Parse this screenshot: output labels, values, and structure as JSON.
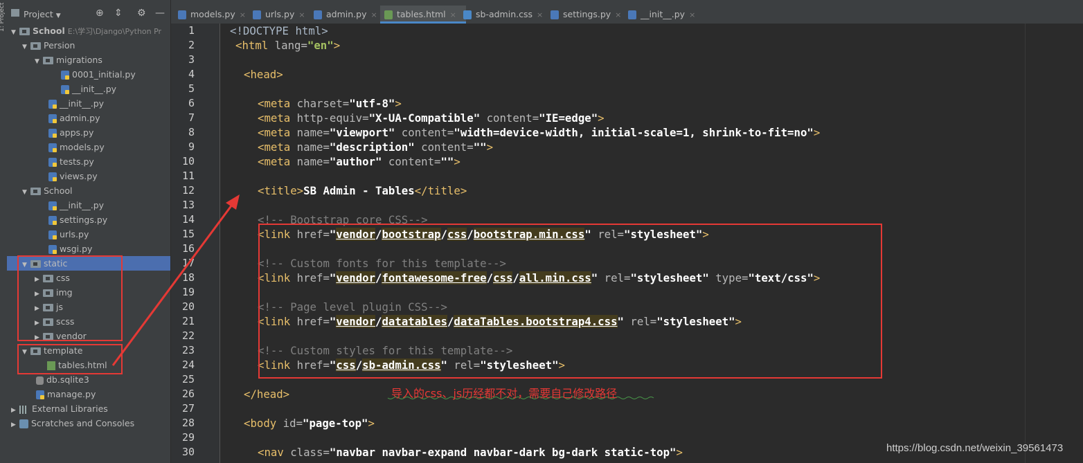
{
  "side_strip": {
    "label": "1: Project"
  },
  "project_panel": {
    "title": "Project",
    "tools": {
      "locate_icon": "crosshair-icon",
      "collapse_icon": "collapse-icon",
      "settings_icon": "gear-icon",
      "hide_icon": "minus-icon"
    },
    "tree": [
      {
        "label": "School",
        "hint": "E:\\学习\\Django\\Python Pr",
        "type": "project-root"
      },
      {
        "label": "Persion",
        "type": "folder"
      },
      {
        "label": "migrations",
        "type": "folder"
      },
      {
        "label": "0001_initial.py",
        "type": "py"
      },
      {
        "label": "__init__.py",
        "type": "py"
      },
      {
        "label": "__init__.py",
        "type": "py"
      },
      {
        "label": "admin.py",
        "type": "py"
      },
      {
        "label": "apps.py",
        "type": "py"
      },
      {
        "label": "models.py",
        "type": "py"
      },
      {
        "label": "tests.py",
        "type": "py"
      },
      {
        "label": "views.py",
        "type": "py"
      },
      {
        "label": "School",
        "type": "folder"
      },
      {
        "label": "__init__.py",
        "type": "py"
      },
      {
        "label": "settings.py",
        "type": "py"
      },
      {
        "label": "urls.py",
        "type": "py"
      },
      {
        "label": "wsgi.py",
        "type": "py"
      },
      {
        "label": "static",
        "type": "folder",
        "selected": true
      },
      {
        "label": "css",
        "type": "folder"
      },
      {
        "label": "img",
        "type": "folder"
      },
      {
        "label": "js",
        "type": "folder"
      },
      {
        "label": "scss",
        "type": "folder"
      },
      {
        "label": "vendor",
        "type": "folder"
      },
      {
        "label": "template",
        "type": "folder"
      },
      {
        "label": "tables.html",
        "type": "html"
      },
      {
        "label": "db.sqlite3",
        "type": "db"
      },
      {
        "label": "manage.py",
        "type": "py"
      },
      {
        "label": "External Libraries",
        "type": "lib"
      },
      {
        "label": "Scratches and Consoles",
        "type": "scratch"
      }
    ]
  },
  "tabs": [
    {
      "label": "models.py",
      "active": false
    },
    {
      "label": "urls.py",
      "active": false
    },
    {
      "label": "admin.py",
      "active": false
    },
    {
      "label": "tables.html",
      "active": true
    },
    {
      "label": "sb-admin.css",
      "active": false
    },
    {
      "label": "settings.py",
      "active": false
    },
    {
      "label": "__init__.py",
      "active": false
    }
  ],
  "close_glyph": "×",
  "editor": {
    "line_numbers": [
      "1",
      "2",
      "3",
      "4",
      "5",
      "6",
      "7",
      "8",
      "9",
      "10",
      "11",
      "12",
      "13",
      "14",
      "15",
      "16",
      "17",
      "18",
      "19",
      "20",
      "21",
      "22",
      "23",
      "24",
      "25",
      "26",
      "27",
      "28",
      "29",
      "30"
    ],
    "lines": {
      "l1": "<!DOCTYPE html>",
      "l2_a": "<html",
      "l2_b": " lang=",
      "l2_c": "\"en\"",
      "l2_d": ">",
      "l4_a": "<head",
      "l4_b": ">",
      "l6_a": "<meta",
      "l6_b": " charset=",
      "l6_c": "\"utf-8\"",
      "l6_d": ">",
      "l7_a": "<meta",
      "l7_b": " http-equiv=",
      "l7_c": "\"X-UA-Compatible\"",
      "l7_d": " content=",
      "l7_e": "\"IE=edge\"",
      "l7_f": ">",
      "l8_a": "<meta",
      "l8_b": " name=",
      "l8_c": "\"viewport\"",
      "l8_d": " content=",
      "l8_e": "\"width=device-width, initial-scale=1, shrink-to-fit=no\"",
      "l8_f": ">",
      "l9_a": "<meta",
      "l9_b": " name=",
      "l9_c": "\"description\"",
      "l9_d": " content=",
      "l9_e": "\"\"",
      "l9_f": ">",
      "l10_a": "<meta",
      "l10_b": " name=",
      "l10_c": "\"author\"",
      "l10_d": " content=",
      "l10_e": "\"\"",
      "l10_f": ">",
      "l12_a": "<title",
      "l12_b": ">",
      "l12_c": "SB Admin - Tables",
      "l12_d": "</title",
      "l12_e": ">",
      "l14": "<!-- Bootstrap core CSS-->",
      "l15_a": "<link",
      "l15_b": " href=",
      "l15_q": "\"",
      "l15_p1": "vendor",
      "l15_s": "/",
      "l15_p2": "bootstrap",
      "l15_p3": "css",
      "l15_p4": "bootstrap.min.css",
      "l15_c": " rel=",
      "l15_d": "\"stylesheet\"",
      "l15_e": ">",
      "l17": "<!-- Custom fonts for this template-->",
      "l18_a": "<link",
      "l18_b": " href=",
      "l18_p1": "vendor",
      "l18_p2": "fontawesome-free",
      "l18_p3": "css",
      "l18_p4": "all.min.css",
      "l18_c": " rel=",
      "l18_d": "\"stylesheet\"",
      "l18_e": " type=",
      "l18_f": "\"text/css\"",
      "l18_g": ">",
      "l20": "<!-- Page level plugin CSS-->",
      "l21_a": "<link",
      "l21_b": " href=",
      "l21_p1": "vendor",
      "l21_p2": "datatables",
      "l21_p3": "dataTables.bootstrap4.css",
      "l21_c": " rel=",
      "l21_d": "\"stylesheet\"",
      "l21_e": ">",
      "l23": "<!-- Custom styles for this template-->",
      "l24_a": "<link",
      "l24_b": " href=",
      "l24_p1": "css",
      "l24_p2": "sb-admin.css",
      "l24_c": " rel=",
      "l24_d": "\"stylesheet\"",
      "l24_e": ">",
      "l26_a": "</head",
      "l26_b": ">",
      "l28_a": "<body",
      "l28_b": " id=",
      "l28_c": "\"page-top\"",
      "l28_d": ">",
      "l30_a": "<nav",
      "l30_b": " class=",
      "l30_c": "\"navbar navbar-expand navbar-dark bg-dark static-top\"",
      "l30_d": ">"
    }
  },
  "annotation": {
    "note": "导入的css、js历经都不对，需要自己修改路径",
    "color": "#e53935"
  },
  "watermark": "https://blog.csdn.net/weixin_39561473"
}
